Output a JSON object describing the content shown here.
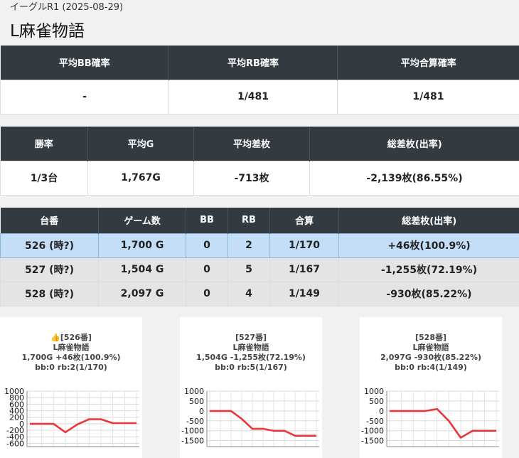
{
  "header": {
    "subtitle": "イーグルR1 (2025-08-29)",
    "title": "L麻雀物語"
  },
  "summary1": {
    "headers": [
      "平均BB確率",
      "平均RB確率",
      "平均合算確率"
    ],
    "values": [
      "-",
      "1/481",
      "1/481"
    ]
  },
  "summary2": {
    "headers": [
      "勝率",
      "平均G",
      "平均差枚",
      "総差枚(出率)"
    ],
    "values": [
      "1/3台",
      "1,767G",
      "-713枚",
      "-2,139枚(86.55%)"
    ]
  },
  "machines": {
    "headers": [
      "台番",
      "ゲーム数",
      "BB",
      "RB",
      "合算",
      "総差枚(出率)"
    ],
    "rows": [
      [
        "526 (時?)",
        "1,700 G",
        "0",
        "2",
        "1/170",
        "+46枚(100.9%)"
      ],
      [
        "527 (時?)",
        "1,504 G",
        "0",
        "5",
        "1/167",
        "-1,255枚(72.19%)"
      ],
      [
        "528 (時?)",
        "2,097 G",
        "0",
        "4",
        "1/149",
        "-930枚(85.22%)"
      ]
    ]
  },
  "cards": [
    {
      "line1": "👍[526番]",
      "line2": "L麻雀物語",
      "line3": "1,700G +46枚(100.9%)",
      "line4": "bb:0 rb:2(1/170)"
    },
    {
      "line1": "[527番]",
      "line2": "L麻雀物語",
      "line3": "1,504G -1,255枚(72.19%)",
      "line4": "bb:0 rb:5(1/167)"
    },
    {
      "line1": "[528番]",
      "line2": "L麻雀物語",
      "line3": "2,097G -930枚(85.22%)",
      "line4": "bb:0 rb:4(1/149)"
    }
  ],
  "chart_data": [
    {
      "type": "line",
      "color": "#e8363a",
      "yticks": [
        1000,
        800,
        600,
        400,
        200,
        0,
        -200,
        -400,
        -600
      ],
      "ylim": [
        -700,
        1000
      ],
      "y": [
        0,
        0,
        0,
        -260,
        -20,
        140,
        140,
        20,
        20,
        20
      ]
    },
    {
      "type": "line",
      "color": "#e8363a",
      "yticks": [
        1000,
        500,
        0,
        -500,
        -1000,
        -1500
      ],
      "ylim": [
        -1800,
        1000
      ],
      "y": [
        0,
        0,
        0,
        -400,
        -900,
        -900,
        -1000,
        -1000,
        -1250,
        -1250,
        -1250
      ]
    },
    {
      "type": "line",
      "color": "#e8363a",
      "yticks": [
        1000,
        500,
        0,
        -500,
        -1000,
        -1500
      ],
      "ylim": [
        -1800,
        1000
      ],
      "y": [
        0,
        0,
        0,
        0,
        100,
        -500,
        -1350,
        -1000,
        -1000,
        -1000
      ]
    }
  ]
}
